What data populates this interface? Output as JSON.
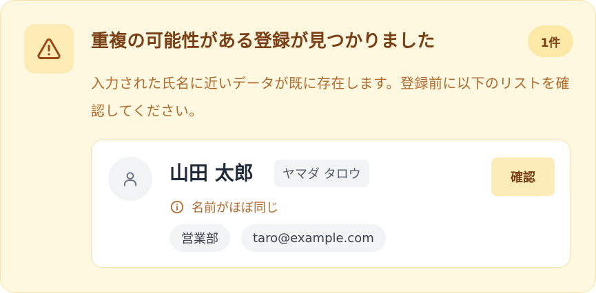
{
  "alert": {
    "title": "重複の可能性がある登録が見つかりました",
    "count_badge": "1件",
    "description": "入力された氏名に近いデータが既に存在します。登録前に以下のリストを確認してください。",
    "icon": "warning-triangle-icon"
  },
  "candidates": [
    {
      "name": "山田 太郎",
      "kana": "ヤマダ タロウ",
      "confirm_label": "確認",
      "match_reason": "名前がほぼ同じ",
      "department": "営業部",
      "email": "taro@example.com",
      "avatar_icon": "user-icon"
    }
  ],
  "colors": {
    "panel_bg": "#fef8e0",
    "accent_dark": "#7a3f14",
    "accent_text": "#b06a2e",
    "badge_bg": "#fce9a8"
  }
}
